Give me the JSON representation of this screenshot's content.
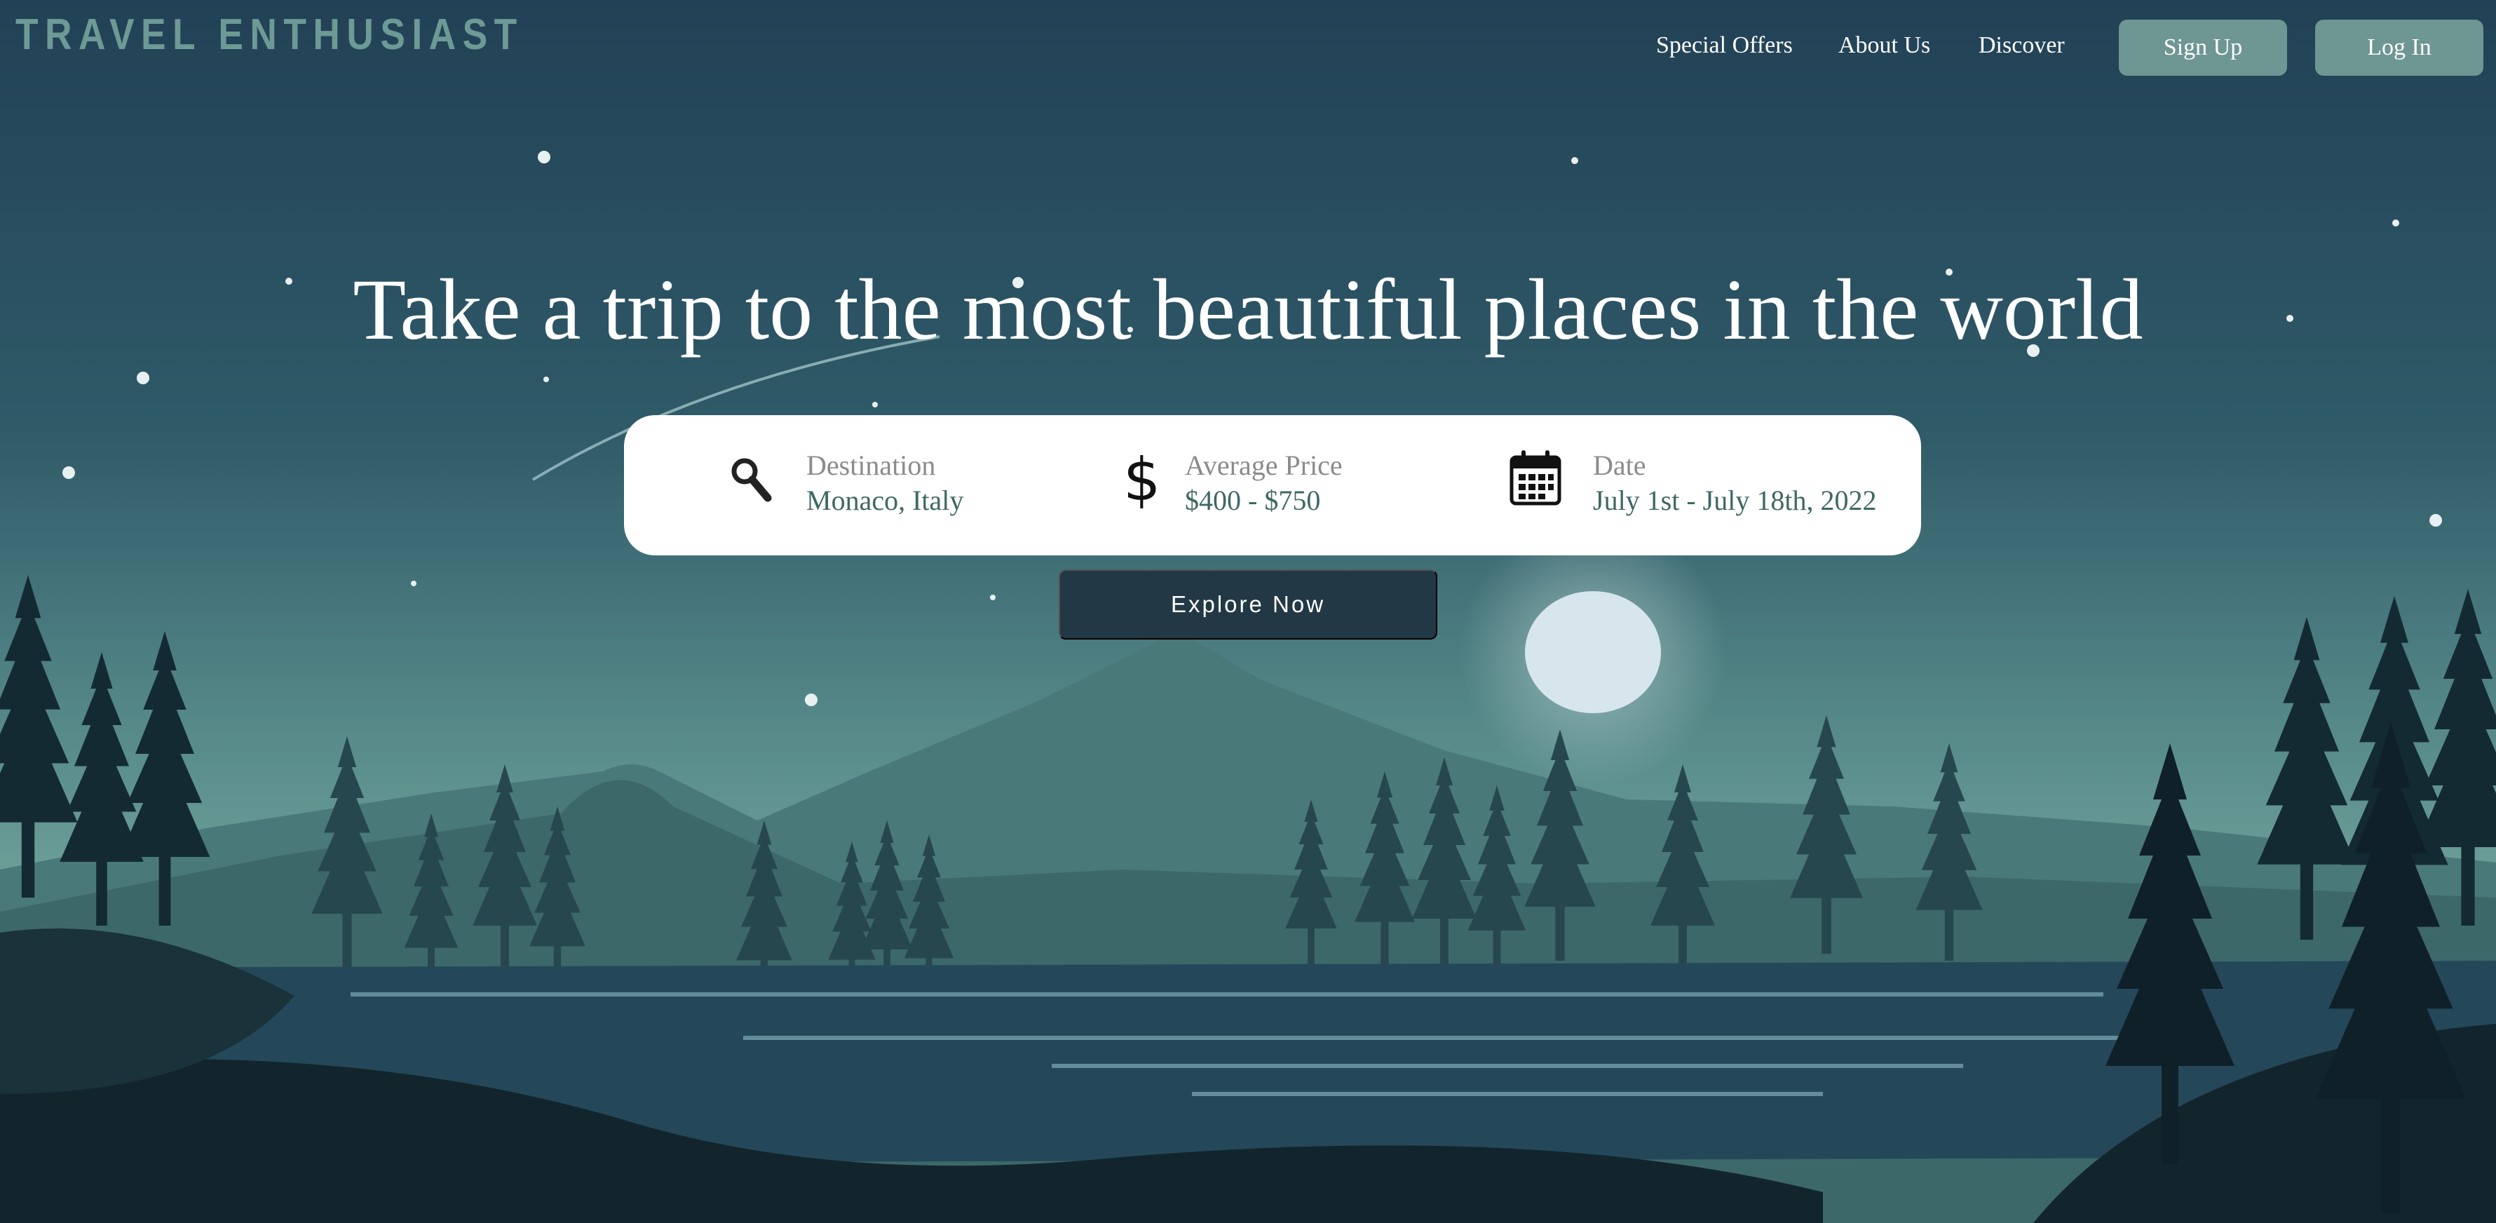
{
  "brand": {
    "logo_text": "TRAVEL ENTHUSIAST"
  },
  "nav": {
    "links": [
      "Special Offers",
      "About Us",
      "Discover"
    ],
    "signup_label": "Sign Up",
    "login_label": "Log In"
  },
  "hero": {
    "headline": "Take a trip to the most beautiful places in the world",
    "explore_label": "Explore Now"
  },
  "search": {
    "destination": {
      "label": "Destination",
      "value": "Monaco, Italy",
      "icon": "search-icon"
    },
    "price": {
      "label": "Average Price",
      "value": "$400 - $750",
      "icon": "dollar-icon"
    },
    "date": {
      "label": "Date",
      "value": "July 1st - July 18th, 2022",
      "icon": "calendar-icon"
    }
  },
  "colors": {
    "accent": "#6e9692",
    "button_dark": "#233845",
    "value_text": "#3e6864",
    "sky_top": "#224156",
    "sky_bottom": "#6d9f98"
  }
}
